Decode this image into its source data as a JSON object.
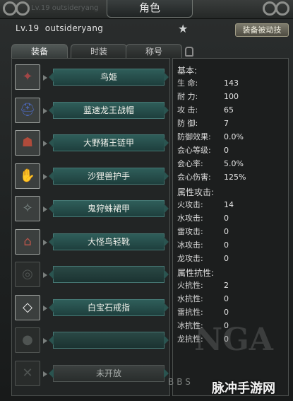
{
  "window": {
    "title": "角色",
    "background_text": "Lv.19 outsideryang"
  },
  "character": {
    "level": "Lv.19",
    "name": "outsideryang",
    "passive_button": "装备被动技"
  },
  "tabs": [
    {
      "label": "装备"
    },
    {
      "label": "时装"
    },
    {
      "label": "称号"
    }
  ],
  "equipment": [
    {
      "name": "鸟姬",
      "icon": "bird-mask-icon",
      "color": "#a24646"
    },
    {
      "name": "蓝速龙王战帽",
      "icon": "helmet-icon",
      "color": "#4b66b6"
    },
    {
      "name": "大野猪王链甲",
      "icon": "chest-armor-icon",
      "color": "#b04b3b"
    },
    {
      "name": "沙狸兽护手",
      "icon": "gauntlet-icon",
      "color": "#c9922f"
    },
    {
      "name": "鬼狩蛛裙甲",
      "icon": "waist-armor-icon",
      "color": "#7d8a88"
    },
    {
      "name": "大怪鸟轻靴",
      "icon": "boots-icon",
      "color": "#b4544a"
    },
    {
      "name": "",
      "icon": "empty-slot-icon",
      "color": "#5b605e"
    },
    {
      "name": "白宝石戒指",
      "icon": "diamond-ring-icon",
      "color": "#e6e6e6"
    },
    {
      "name": "",
      "icon": "pouch-slot-icon",
      "color": "#5b605e"
    },
    {
      "name": "未开放",
      "icon": "locked-slot-icon",
      "color": "#5b605e"
    }
  ],
  "stats": {
    "basic_header": "基本:",
    "basic": [
      {
        "label": "生 命:",
        "value": "143"
      },
      {
        "label": "耐 力:",
        "value": "100"
      },
      {
        "label": "攻 击:",
        "value": "65"
      },
      {
        "label": "防 御:",
        "value": "7"
      },
      {
        "label": "防御效果:",
        "value": "0.0%"
      },
      {
        "label": "会心等级:",
        "value": "0"
      },
      {
        "label": "会心率:",
        "value": "5.0%"
      },
      {
        "label": "会心伤害:",
        "value": "125%"
      }
    ],
    "attack_header": "属性攻击:",
    "attack": [
      {
        "label": "火攻击:",
        "value": "14"
      },
      {
        "label": "水攻击:",
        "value": "0"
      },
      {
        "label": "雷攻击:",
        "value": "0"
      },
      {
        "label": "冰攻击:",
        "value": "0"
      },
      {
        "label": "龙攻击:",
        "value": "0"
      }
    ],
    "resist_header": "属性抗性:",
    "resist": [
      {
        "label": "火抗性:",
        "value": "2"
      },
      {
        "label": "水抗性:",
        "value": "0"
      },
      {
        "label": "雷抗性:",
        "value": "0"
      },
      {
        "label": "冰抗性:",
        "value": "0"
      },
      {
        "label": "龙抗性:",
        "value": "0"
      }
    ]
  },
  "watermarks": {
    "site": "脉冲手游网",
    "bbs": "BBS",
    "nga": "NGA"
  }
}
